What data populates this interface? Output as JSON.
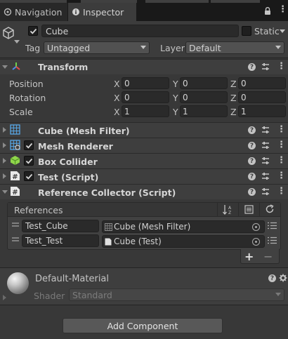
{
  "tabs": [
    {
      "label": "Navigation",
      "icon": "navigation-icon"
    },
    {
      "label": "Inspector",
      "icon": "inspector-icon"
    }
  ],
  "header": {
    "object_name": "Cube",
    "static_label": "Static",
    "tag_label": "Tag",
    "tag_value": "Untagged",
    "layer_label": "Layer",
    "layer_value": "Default",
    "active": true,
    "static": false
  },
  "transform": {
    "title": "Transform",
    "rows": [
      {
        "label": "Position",
        "x": "0",
        "y": "0",
        "z": "0"
      },
      {
        "label": "Rotation",
        "x": "0",
        "y": "0",
        "z": "0"
      },
      {
        "label": "Scale",
        "x": "1",
        "y": "1",
        "z": "1"
      }
    ],
    "axis_labels": [
      "X",
      "Y",
      "Z"
    ]
  },
  "components": [
    {
      "title": "Cube (Mesh Filter)",
      "icon": "mesh-filter-icon",
      "has_checkbox": false
    },
    {
      "title": "Mesh Renderer",
      "icon": "mesh-renderer-icon",
      "has_checkbox": true
    },
    {
      "title": "Box Collider",
      "icon": "box-collider-icon",
      "has_checkbox": true
    },
    {
      "title": "Test (Script)",
      "icon": "script-icon",
      "has_checkbox": true
    },
    {
      "title": "Reference Collector (Script)",
      "icon": "script-icon",
      "has_checkbox": false
    }
  ],
  "references": {
    "label": "References",
    "items": [
      {
        "key": "Test_Cube",
        "value": "Cube (Mesh Filter)",
        "value_icon": "mesh-filter-icon"
      },
      {
        "key": "Test_Test",
        "value": "Cube (Test)",
        "value_icon": "script-file-icon"
      }
    ],
    "add_label": "+",
    "remove_label": "−"
  },
  "material": {
    "name": "Default-Material",
    "shader_label": "Shader",
    "shader_value": "Standard"
  },
  "add_component_label": "Add Component",
  "colors": {
    "background": "#383838",
    "header": "#3e3e3e",
    "field": "#2a2a2a",
    "text": "#c4c4c4"
  }
}
